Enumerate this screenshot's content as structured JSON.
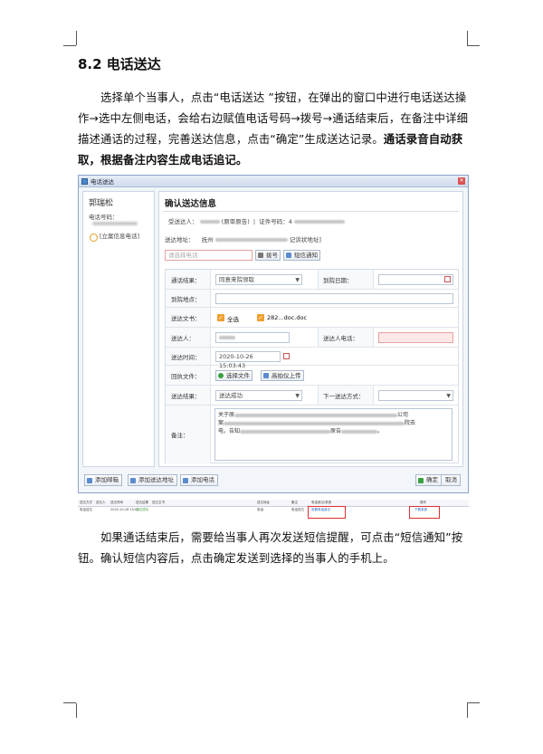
{
  "doc": {
    "heading": "8.2  电话送达",
    "para1_lines": [
      "选择单个当事人，点击“电话送达 ”按钮，在弹出的窗口中进行电话送达操",
      "作→选中左侧电话，会给右边赋值电话号码→拨号→通话结束后，在备注中详细",
      "描述通话的过程，完善送达信息，点击“确定”生成送达记录。"
    ],
    "para1_bold_a": "通话录音自动获",
    "para1_bold_b": "取，根据备注内容生成电话追记。",
    "para2": "如果通话结束后，需要给当事人再次发送短信提醒，可点击“短信通知”按钮。确认短信内容后，点击确定发送到选择的当事人的手机上。"
  },
  "dialog": {
    "window_title": "电话送达",
    "close_glyph": "✕",
    "left": {
      "party_name": "郭瑞松",
      "phone_label": "电话号码：",
      "phone_option": "[立案信息电话]"
    },
    "right": {
      "title": "确认送达信息",
      "recipient_label": "受送达人：",
      "recipient_suffix": "(原审原告)",
      "id_label": "证件号码：4",
      "address_label": "送达地址：",
      "address_prefix": "抚州",
      "address_suffix": "记诉状地址]",
      "phone_placeholder": "请选择电话",
      "dial_button": "拨号",
      "sms_button": "短信通知",
      "fields": {
        "call_result_label": "通话结果：",
        "call_result_value": "同意来院领取",
        "arrive_date_label": "到院日期：",
        "arrive_place_label": "到院地点：",
        "documents_label": "送达文书：",
        "select_all": "全选",
        "doc_file": "282...doc.doc",
        "server_label": "送达人：",
        "server_phone_label": "送达人电话：",
        "time_label": "送达时间：",
        "time_value": "2020-10-26 15:03:43",
        "receipt_label": "回执文件：",
        "choose_file": "选择文件",
        "scanner_upload": "高拍仪上传",
        "result_label": "送达结果：",
        "result_value": "送达成功",
        "next_method_label": "下一送达方式：",
        "note_label": "备注：",
        "note_line1": "关于原",
        "note_line1_end": "公司",
        "note_line2": "案",
        "note_line2_end": "院去",
        "note_line3": "电，告知",
        "note_line3_mid": "原告",
        "note_line3_end": "。"
      }
    },
    "footer": {
      "add_mail": "添加邮箱",
      "add_address": "添加送达地址",
      "add_phone": "添加电话",
      "ok": "确定",
      "cancel": "取消"
    }
  },
  "record": {
    "headers": [
      "送达方式",
      "送达人",
      "送达时间",
      "送达结果",
      "送达文书",
      "送达地址",
      "备注",
      "电话追记/录音",
      "操作"
    ],
    "row": [
      "电话送达",
      "",
      "2020-10-26 15:03",
      "送达成功",
      "",
      "电话：",
      "电话送达",
      "查看电话追记",
      "下载录音"
    ]
  }
}
